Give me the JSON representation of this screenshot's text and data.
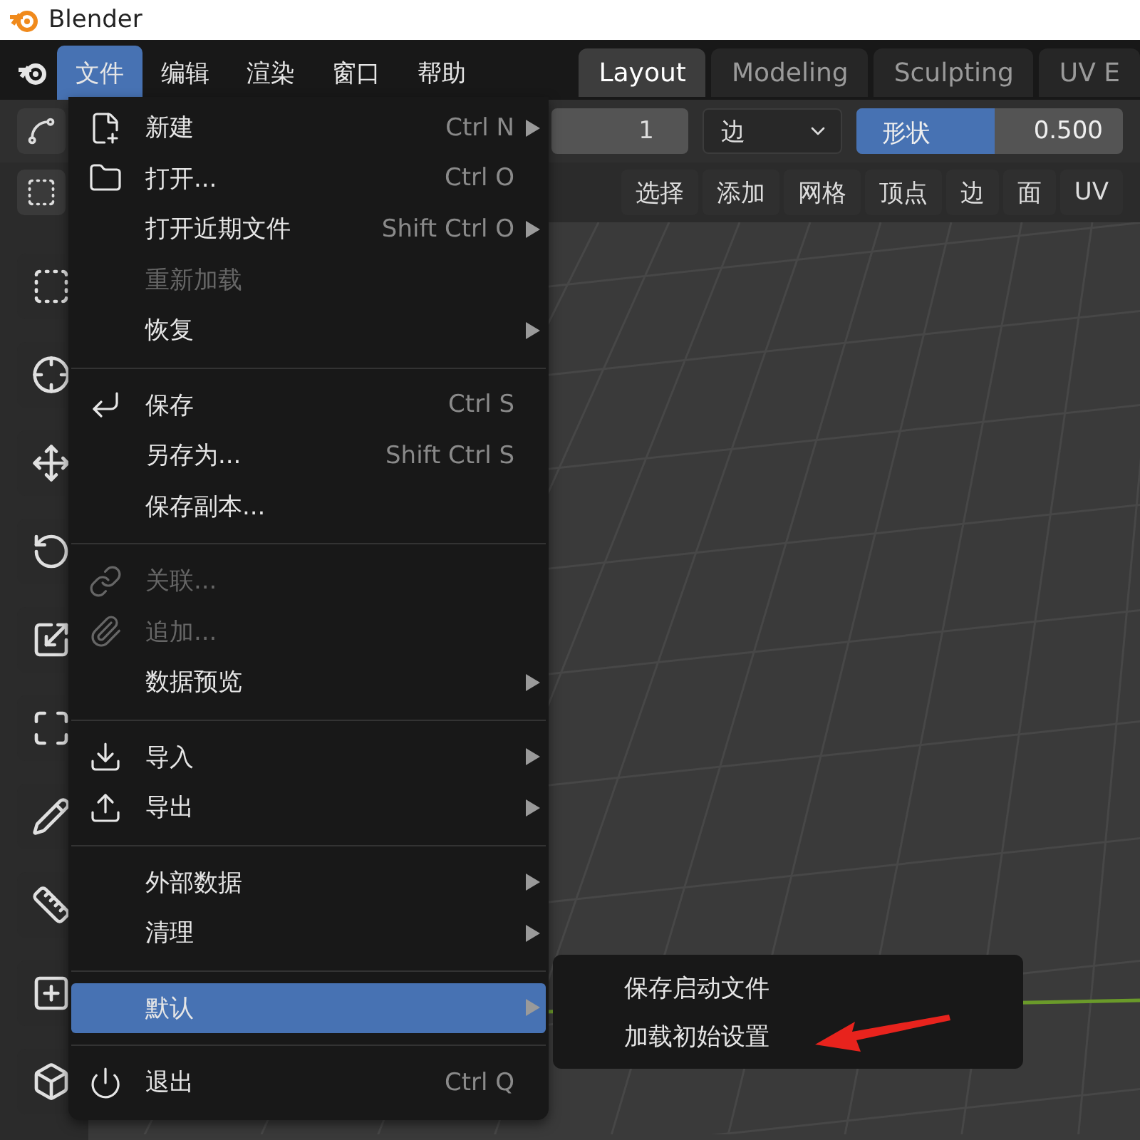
{
  "window": {
    "title": "Blender"
  },
  "menubar": {
    "items": [
      {
        "label": "文件",
        "selected": true
      },
      {
        "label": "编辑",
        "selected": false
      },
      {
        "label": "渲染",
        "selected": false
      },
      {
        "label": "窗口",
        "selected": false
      },
      {
        "label": "帮助",
        "selected": false
      }
    ]
  },
  "workspace_tabs": [
    {
      "label": "Layout",
      "selected": true
    },
    {
      "label": "Modeling",
      "selected": false
    },
    {
      "label": "Sculpting",
      "selected": false
    },
    {
      "label": "UV E",
      "selected": false
    }
  ],
  "tool_header": {
    "segments_field": "1",
    "mode_select": "边",
    "shape_slider": {
      "label": "形状",
      "value": "0.500",
      "level": 0.52
    }
  },
  "editor_menu": [
    "选择",
    "添加",
    "网格",
    "顶点",
    "边",
    "面",
    "UV"
  ],
  "file_menu": {
    "sections": [
      [
        {
          "label": "新建",
          "shortcut": "Ctrl N",
          "submenu": true,
          "disabled": false,
          "selected": false
        },
        {
          "label": "打开...",
          "shortcut": "Ctrl O",
          "submenu": false,
          "disabled": false,
          "selected": false
        },
        {
          "label": "打开近期文件",
          "shortcut": "Shift Ctrl O",
          "submenu": true,
          "disabled": false,
          "selected": false
        },
        {
          "label": "重新加载",
          "submenu": false,
          "disabled": true,
          "selected": false
        },
        {
          "label": "恢复",
          "submenu": true,
          "disabled": false,
          "selected": false
        }
      ],
      [
        {
          "label": "保存",
          "shortcut": "Ctrl S",
          "submenu": false,
          "disabled": false,
          "selected": false
        },
        {
          "label": "另存为...",
          "shortcut": "Shift Ctrl S",
          "submenu": false,
          "disabled": false,
          "selected": false
        },
        {
          "label": "保存副本...",
          "submenu": false,
          "disabled": false,
          "selected": false
        }
      ],
      [
        {
          "label": "关联...",
          "submenu": false,
          "disabled": true,
          "selected": false
        },
        {
          "label": "追加...",
          "submenu": false,
          "disabled": true,
          "selected": false
        },
        {
          "label": "数据预览",
          "submenu": true,
          "disabled": false,
          "selected": false
        }
      ],
      [
        {
          "label": "导入",
          "submenu": true,
          "disabled": false,
          "selected": false
        },
        {
          "label": "导出",
          "submenu": true,
          "disabled": false,
          "selected": false
        }
      ],
      [
        {
          "label": "外部数据",
          "submenu": true,
          "disabled": false,
          "selected": false
        },
        {
          "label": "清理",
          "submenu": true,
          "disabled": false,
          "selected": false
        }
      ],
      [
        {
          "label": "默认",
          "submenu": true,
          "disabled": false,
          "selected": true
        }
      ],
      [
        {
          "label": "退出",
          "shortcut": "Ctrl Q",
          "submenu": false,
          "disabled": false,
          "selected": false
        }
      ]
    ]
  },
  "defaults_submenu": {
    "items": [
      "保存启动文件",
      "加载初始设置"
    ]
  }
}
